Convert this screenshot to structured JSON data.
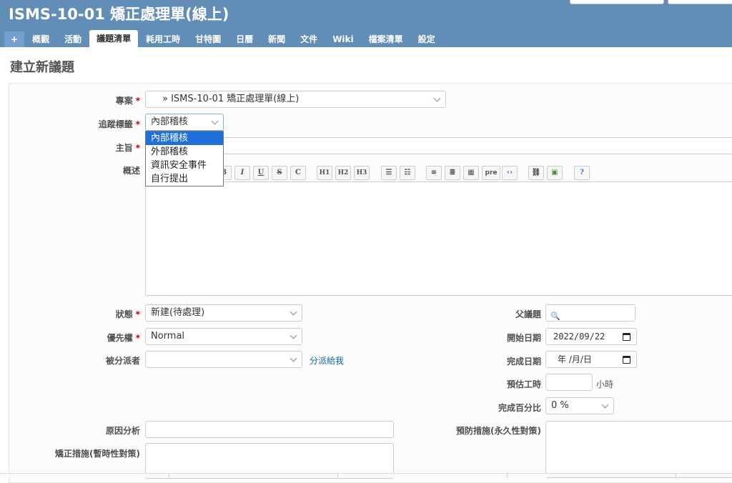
{
  "header": {
    "title": "ISMS-10-01 矯正處理單(線上)"
  },
  "menu": {
    "new_label": "+",
    "items": [
      {
        "label": "概觀"
      },
      {
        "label": "活動"
      },
      {
        "label": "議題清單"
      },
      {
        "label": "耗用工時"
      },
      {
        "label": "甘特圖"
      },
      {
        "label": "日曆"
      },
      {
        "label": "新聞"
      },
      {
        "label": "文件"
      },
      {
        "label": "Wiki"
      },
      {
        "label": "檔案清單"
      },
      {
        "label": "設定"
      }
    ],
    "selected": "議題清單"
  },
  "page_title": "建立新議題",
  "form": {
    "project": {
      "label": "專案",
      "value": "» ISMS-10-01 矯正處理單(線上)"
    },
    "tracker": {
      "label": "追蹤標籤",
      "value": "內部稽核",
      "options": [
        "內部稽核",
        "外部稽核",
        "資訊安全事件",
        "自行提出"
      ]
    },
    "subject": {
      "label": "主旨",
      "value": ""
    },
    "description": {
      "label": "概述"
    },
    "toolbar": [
      "B",
      "I",
      "U",
      "S",
      "C",
      "H1",
      "H2",
      "H3",
      "ul",
      "ol",
      "«",
      "»",
      "tbl",
      "pre",
      "<>",
      "img-link",
      "img",
      "?"
    ],
    "status": {
      "label": "狀態",
      "value": "新建(待處理)"
    },
    "priority": {
      "label": "優先權",
      "value": "Normal"
    },
    "assignee": {
      "label": "被分派者",
      "value": "",
      "assign_me": "分派給我"
    },
    "parent": {
      "label": "父議題",
      "value": ""
    },
    "start_date": {
      "label": "開始日期",
      "value": "2022/09/22"
    },
    "due_date": {
      "label": "完成日期",
      "value": "年 /月/日"
    },
    "estimated": {
      "label": "預估工時",
      "value": "",
      "unit": "小時"
    },
    "done_ratio": {
      "label": "完成百分比",
      "value": "0 %"
    },
    "cause": {
      "label": "原因分析",
      "value": ""
    },
    "prevention": {
      "label": "預防措施(永久性對策)"
    },
    "correction": {
      "label": "矯正措施(暫時性對策)"
    }
  },
  "colors": {
    "header": "#628db6",
    "menu_tab": "#759fcf",
    "required": "#bb0000",
    "link": "#116699",
    "selected_option": "#1e6fd9"
  }
}
